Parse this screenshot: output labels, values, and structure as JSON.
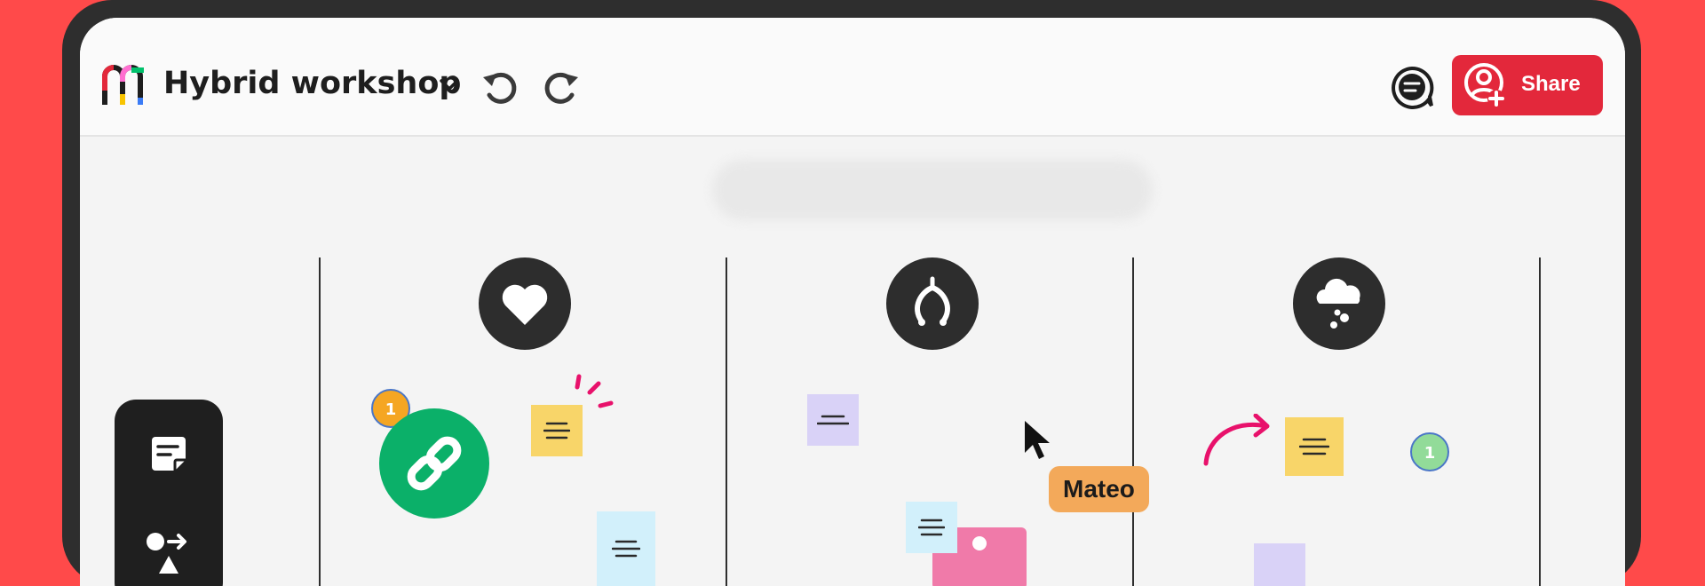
{
  "board": {
    "title": "Hybrid workshop"
  },
  "header": {
    "share_label": "Share"
  },
  "icons": {
    "logo": "app-logo",
    "title_menu": "chevron-down-icon",
    "undo": "undo-icon",
    "redo": "redo-icon",
    "comments": "comments-icon",
    "share": "add-user-icon"
  },
  "columns": [
    {
      "icon": "heart-icon"
    },
    {
      "icon": "wishbone-icon"
    },
    {
      "icon": "rain-cloud-icon"
    }
  ],
  "toolbar": {
    "tools": [
      {
        "icon": "sticky-note-icon"
      },
      {
        "icon": "flowchart-shapes-icon"
      }
    ]
  },
  "canvas": {
    "badges": [
      {
        "count": "1",
        "color": "#f5a623"
      },
      {
        "count": "1",
        "color": "#92db99"
      }
    ],
    "cursor": {
      "user": "Mateo",
      "color": "#f3a95a"
    },
    "sticky_colors": {
      "yellow": "#f8d569",
      "lavender": "#d9d2f7",
      "light_blue": "#d2f0fb",
      "pink": "#f07aa9"
    }
  },
  "colors": {
    "background": "#ff4a4a",
    "device_frame": "#2e2e2e",
    "share_button": "#e3283b",
    "link_circle": "#0bb069",
    "accent_magenta": "#e8116b"
  }
}
